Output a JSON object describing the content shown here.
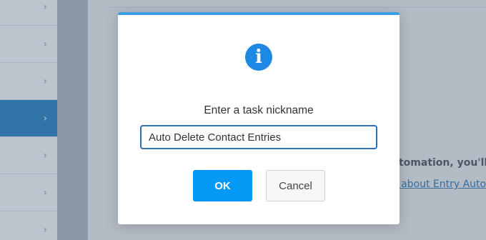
{
  "background": {
    "left_chevron": "›",
    "automation_text": "utomation, you'll ne",
    "link_text": "e about Entry Autom"
  },
  "dialog": {
    "icon": "info-icon",
    "icon_glyph": "i",
    "prompt": "Enter a task nickname",
    "input_value": "Auto Delete Contact Entries",
    "ok_label": "OK",
    "cancel_label": "Cancel"
  },
  "colors": {
    "accent_blue": "#0399f5",
    "modal_top_border": "#3d9ee6",
    "sidebar_active": "#1f7ec1"
  }
}
